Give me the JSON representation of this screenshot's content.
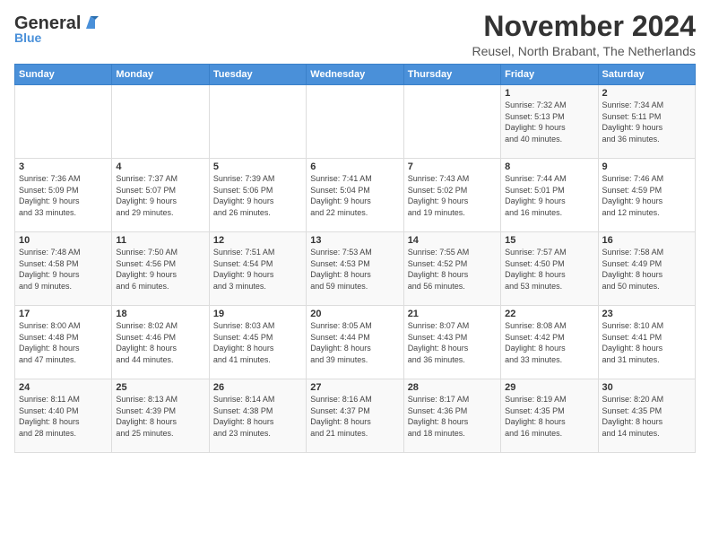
{
  "logo": {
    "general": "General",
    "blue": "Blue"
  },
  "title": "November 2024",
  "location": "Reusel, North Brabant, The Netherlands",
  "days_of_week": [
    "Sunday",
    "Monday",
    "Tuesday",
    "Wednesday",
    "Thursday",
    "Friday",
    "Saturday"
  ],
  "weeks": [
    [
      {
        "day": "",
        "info": ""
      },
      {
        "day": "",
        "info": ""
      },
      {
        "day": "",
        "info": ""
      },
      {
        "day": "",
        "info": ""
      },
      {
        "day": "",
        "info": ""
      },
      {
        "day": "1",
        "info": "Sunrise: 7:32 AM\nSunset: 5:13 PM\nDaylight: 9 hours\nand 40 minutes."
      },
      {
        "day": "2",
        "info": "Sunrise: 7:34 AM\nSunset: 5:11 PM\nDaylight: 9 hours\nand 36 minutes."
      }
    ],
    [
      {
        "day": "3",
        "info": "Sunrise: 7:36 AM\nSunset: 5:09 PM\nDaylight: 9 hours\nand 33 minutes."
      },
      {
        "day": "4",
        "info": "Sunrise: 7:37 AM\nSunset: 5:07 PM\nDaylight: 9 hours\nand 29 minutes."
      },
      {
        "day": "5",
        "info": "Sunrise: 7:39 AM\nSunset: 5:06 PM\nDaylight: 9 hours\nand 26 minutes."
      },
      {
        "day": "6",
        "info": "Sunrise: 7:41 AM\nSunset: 5:04 PM\nDaylight: 9 hours\nand 22 minutes."
      },
      {
        "day": "7",
        "info": "Sunrise: 7:43 AM\nSunset: 5:02 PM\nDaylight: 9 hours\nand 19 minutes."
      },
      {
        "day": "8",
        "info": "Sunrise: 7:44 AM\nSunset: 5:01 PM\nDaylight: 9 hours\nand 16 minutes."
      },
      {
        "day": "9",
        "info": "Sunrise: 7:46 AM\nSunset: 4:59 PM\nDaylight: 9 hours\nand 12 minutes."
      }
    ],
    [
      {
        "day": "10",
        "info": "Sunrise: 7:48 AM\nSunset: 4:58 PM\nDaylight: 9 hours\nand 9 minutes."
      },
      {
        "day": "11",
        "info": "Sunrise: 7:50 AM\nSunset: 4:56 PM\nDaylight: 9 hours\nand 6 minutes."
      },
      {
        "day": "12",
        "info": "Sunrise: 7:51 AM\nSunset: 4:54 PM\nDaylight: 9 hours\nand 3 minutes."
      },
      {
        "day": "13",
        "info": "Sunrise: 7:53 AM\nSunset: 4:53 PM\nDaylight: 8 hours\nand 59 minutes."
      },
      {
        "day": "14",
        "info": "Sunrise: 7:55 AM\nSunset: 4:52 PM\nDaylight: 8 hours\nand 56 minutes."
      },
      {
        "day": "15",
        "info": "Sunrise: 7:57 AM\nSunset: 4:50 PM\nDaylight: 8 hours\nand 53 minutes."
      },
      {
        "day": "16",
        "info": "Sunrise: 7:58 AM\nSunset: 4:49 PM\nDaylight: 8 hours\nand 50 minutes."
      }
    ],
    [
      {
        "day": "17",
        "info": "Sunrise: 8:00 AM\nSunset: 4:48 PM\nDaylight: 8 hours\nand 47 minutes."
      },
      {
        "day": "18",
        "info": "Sunrise: 8:02 AM\nSunset: 4:46 PM\nDaylight: 8 hours\nand 44 minutes."
      },
      {
        "day": "19",
        "info": "Sunrise: 8:03 AM\nSunset: 4:45 PM\nDaylight: 8 hours\nand 41 minutes."
      },
      {
        "day": "20",
        "info": "Sunrise: 8:05 AM\nSunset: 4:44 PM\nDaylight: 8 hours\nand 39 minutes."
      },
      {
        "day": "21",
        "info": "Sunrise: 8:07 AM\nSunset: 4:43 PM\nDaylight: 8 hours\nand 36 minutes."
      },
      {
        "day": "22",
        "info": "Sunrise: 8:08 AM\nSunset: 4:42 PM\nDaylight: 8 hours\nand 33 minutes."
      },
      {
        "day": "23",
        "info": "Sunrise: 8:10 AM\nSunset: 4:41 PM\nDaylight: 8 hours\nand 31 minutes."
      }
    ],
    [
      {
        "day": "24",
        "info": "Sunrise: 8:11 AM\nSunset: 4:40 PM\nDaylight: 8 hours\nand 28 minutes."
      },
      {
        "day": "25",
        "info": "Sunrise: 8:13 AM\nSunset: 4:39 PM\nDaylight: 8 hours\nand 25 minutes."
      },
      {
        "day": "26",
        "info": "Sunrise: 8:14 AM\nSunset: 4:38 PM\nDaylight: 8 hours\nand 23 minutes."
      },
      {
        "day": "27",
        "info": "Sunrise: 8:16 AM\nSunset: 4:37 PM\nDaylight: 8 hours\nand 21 minutes."
      },
      {
        "day": "28",
        "info": "Sunrise: 8:17 AM\nSunset: 4:36 PM\nDaylight: 8 hours\nand 18 minutes."
      },
      {
        "day": "29",
        "info": "Sunrise: 8:19 AM\nSunset: 4:35 PM\nDaylight: 8 hours\nand 16 minutes."
      },
      {
        "day": "30",
        "info": "Sunrise: 8:20 AM\nSunset: 4:35 PM\nDaylight: 8 hours\nand 14 minutes."
      }
    ]
  ]
}
